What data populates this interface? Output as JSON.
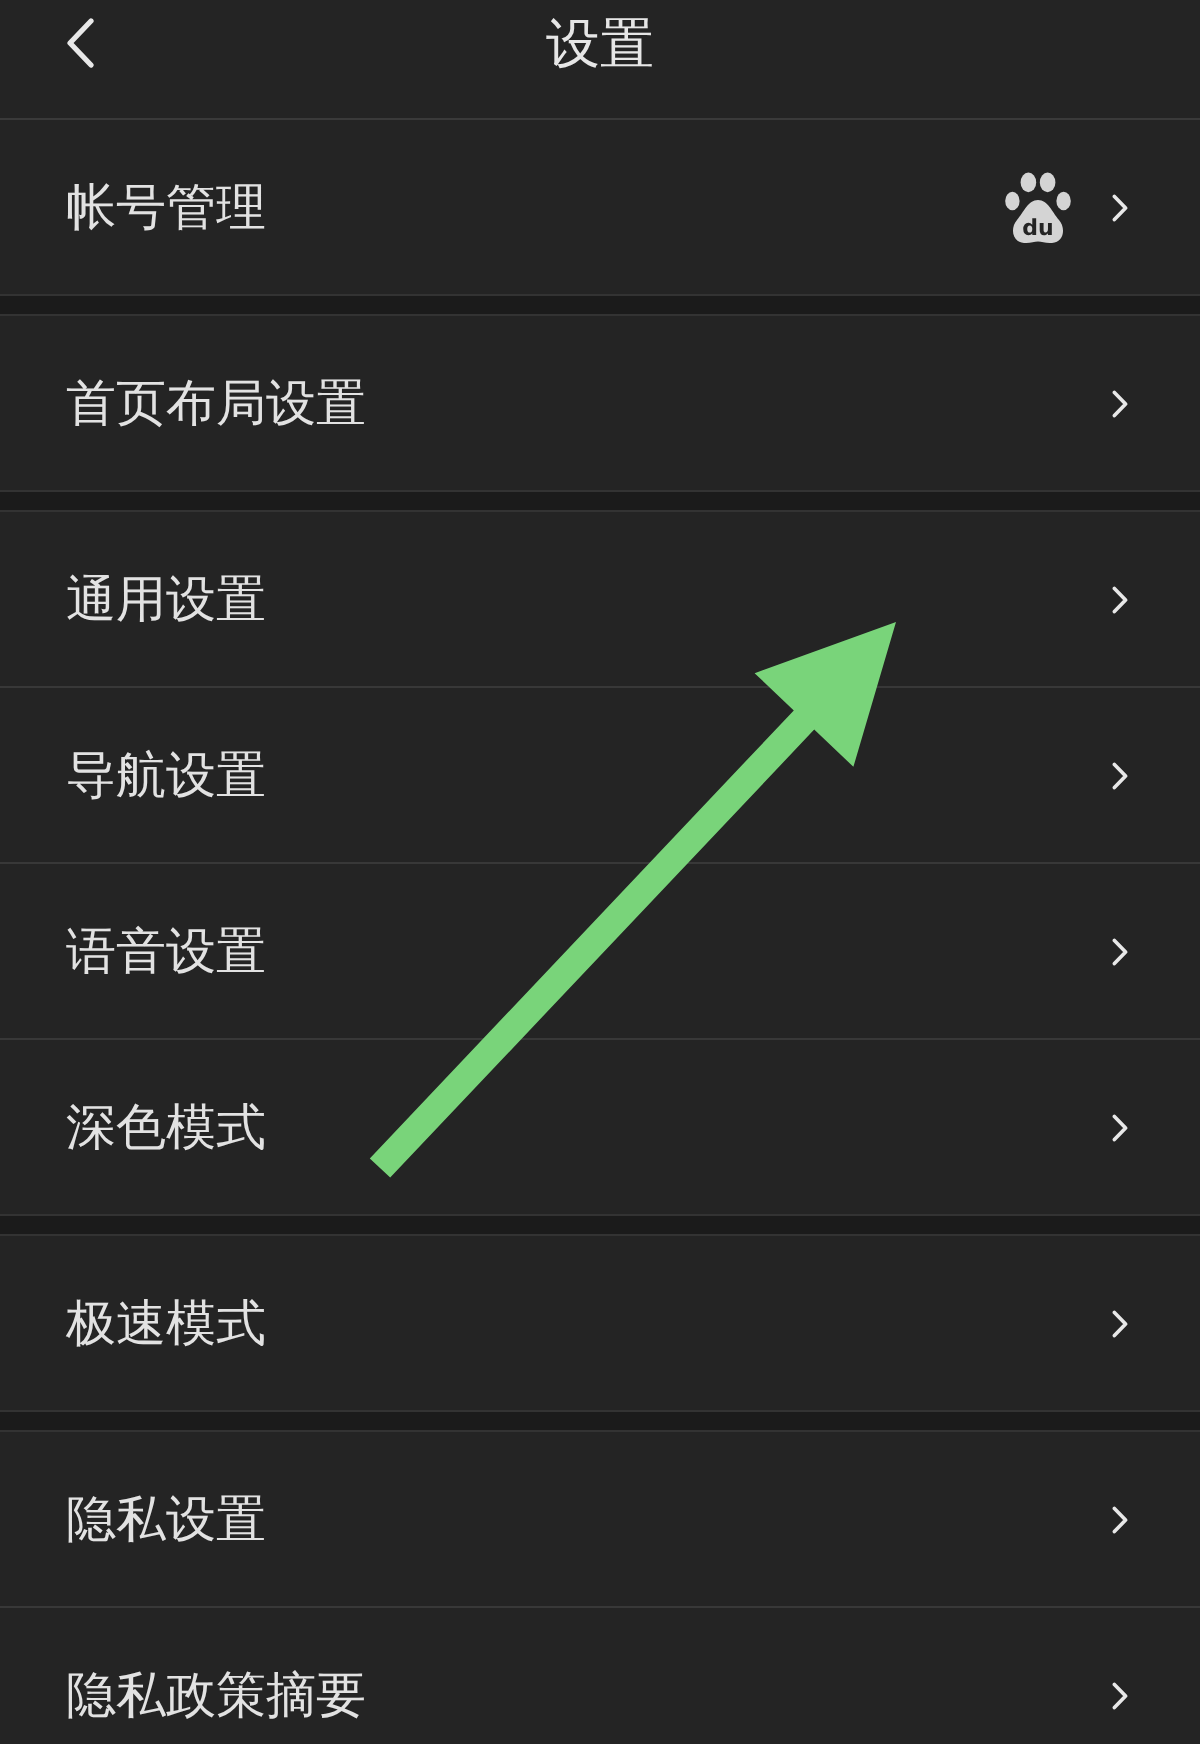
{
  "header": {
    "title": "设置"
  },
  "groups": [
    {
      "items": [
        {
          "label": "帐号管理",
          "logo_text": "du"
        }
      ]
    },
    {
      "items": [
        {
          "label": "首页布局设置"
        }
      ]
    },
    {
      "items": [
        {
          "label": "通用设置"
        },
        {
          "label": "导航设置"
        },
        {
          "label": "语音设置"
        },
        {
          "label": "深色模式"
        }
      ]
    },
    {
      "items": [
        {
          "label": "极速模式"
        }
      ]
    },
    {
      "items": [
        {
          "label": "隐私设置"
        },
        {
          "label": "隐私政策摘要"
        }
      ]
    }
  ]
}
